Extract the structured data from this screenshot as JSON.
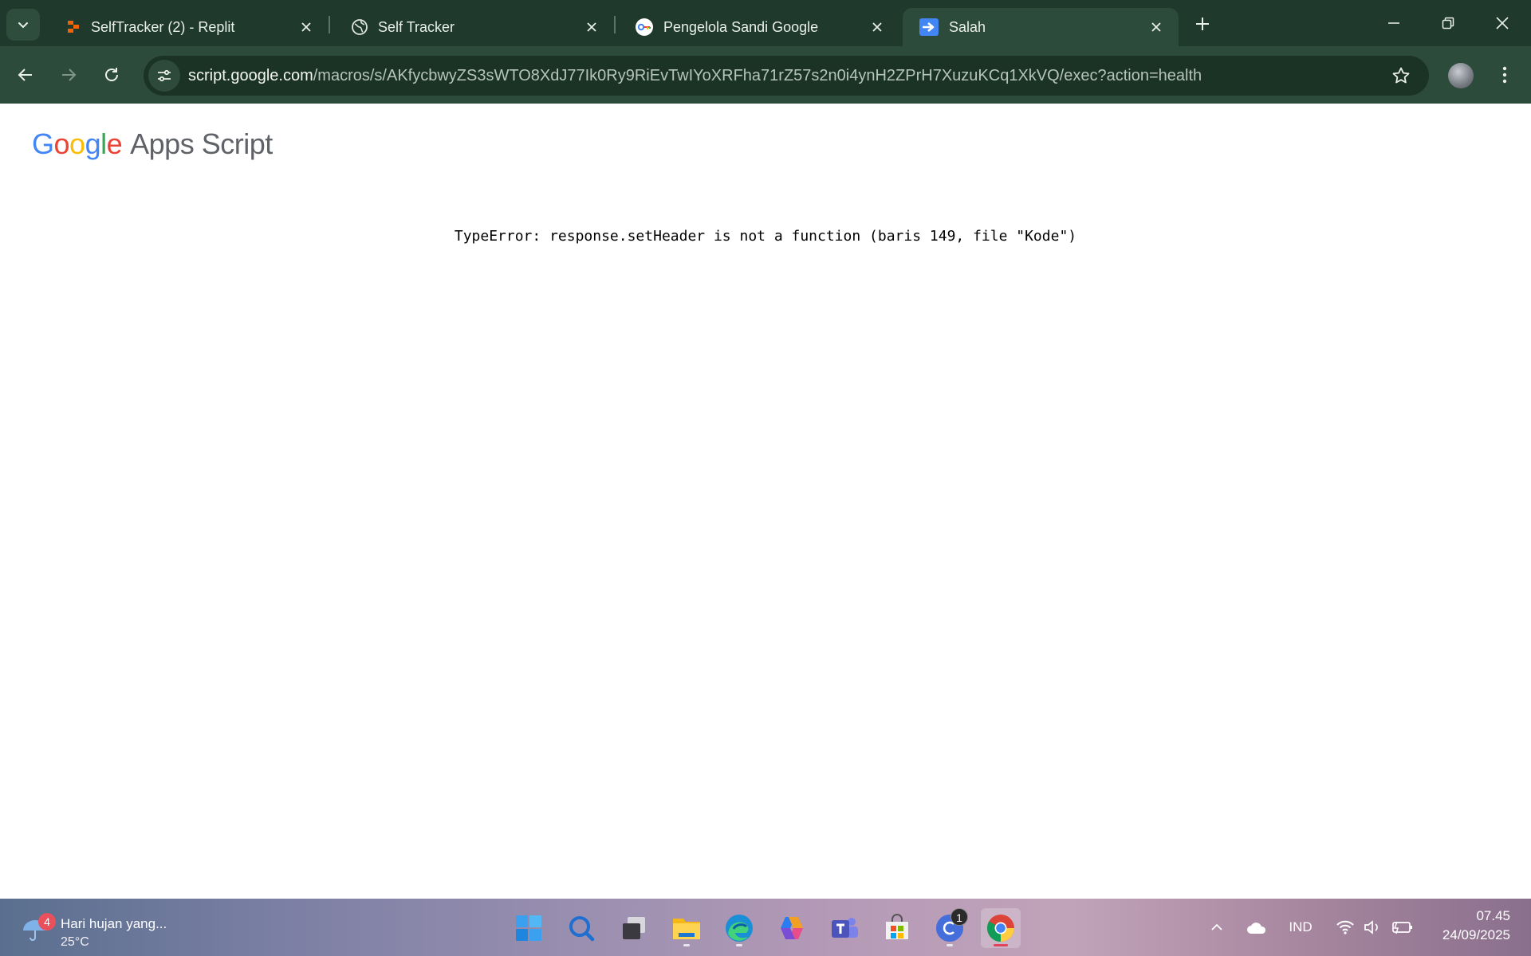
{
  "browser": {
    "tabs": [
      {
        "title": "SelfTracker (2) - Replit",
        "icon": "replit-icon"
      },
      {
        "title": "Self Tracker",
        "icon": "globe-icon"
      },
      {
        "title": "Pengelola Sandi Google",
        "icon": "google-password-manager-icon"
      },
      {
        "title": "Salah",
        "icon": "apps-script-redirect-icon",
        "active": true
      }
    ],
    "address": {
      "domain": "script.google.com",
      "path": "/macros/s/AKfycbwyZS3sWTO8XdJ77Ik0Ry9RiEvTwIYoXRFha71rZ57s2n0i4ynH2ZPrH7XuzuKCq1XkVQ/exec?action=health"
    }
  },
  "page": {
    "logo_letters": [
      "G",
      "o",
      "o",
      "g",
      "l",
      "e"
    ],
    "logo_product": "Apps Script",
    "error_message": "TypeError: response.setHeader is not a function (baris 149, file \"Kode\")"
  },
  "taskbar": {
    "weather": {
      "badge": "4",
      "title": "Hari hujan yang...",
      "temp": "25°C"
    },
    "apps": [
      "start-icon",
      "search-icon",
      "task-view-icon",
      "file-explorer-icon",
      "edge-icon",
      "copilot-icon",
      "teams-icon",
      "store-icon",
      "canva-icon",
      "chrome-icon"
    ],
    "canva_badge": "1",
    "tray": {
      "language": "IND"
    },
    "clock": {
      "time": "07.45",
      "date": "24/09/2025"
    }
  },
  "colors": {
    "chrome_dark": "#1f3a2c",
    "chrome_toolbar": "#2d4b3b",
    "google_blue": "#4285f4",
    "google_red": "#ea4335",
    "google_yellow": "#fbbc05",
    "google_green": "#34a853"
  }
}
